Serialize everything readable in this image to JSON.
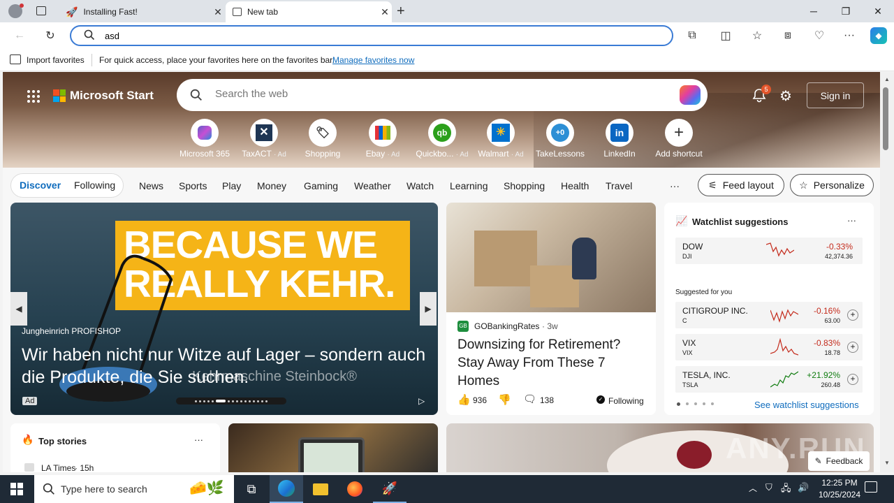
{
  "browser": {
    "tabs": [
      {
        "title": "Installing Fast!"
      },
      {
        "title": "New tab"
      }
    ],
    "address_value": "asd",
    "favbar": {
      "import_label": "Import favorites",
      "hint": "For quick access, place your favorites here on the favorites bar.",
      "manage_link": "Manage favorites now"
    }
  },
  "start": {
    "brand": "Microsoft Start",
    "search_placeholder": "Search the web",
    "notification_count": "5",
    "sign_in": "Sign in",
    "shortcuts": [
      {
        "label": "Microsoft 365",
        "ad": ""
      },
      {
        "label": "TaxACT",
        "ad": "· Ad"
      },
      {
        "label": "Shopping",
        "ad": ""
      },
      {
        "label": "Ebay",
        "ad": "· Ad"
      },
      {
        "label": "Quickbo...",
        "ad": "· Ad"
      },
      {
        "label": "Walmart",
        "ad": "· Ad"
      },
      {
        "label": "TakeLessons",
        "ad": ""
      },
      {
        "label": "LinkedIn",
        "ad": ""
      },
      {
        "label": "Add shortcut",
        "ad": ""
      }
    ]
  },
  "nav": {
    "discover": "Discover",
    "following": "Following",
    "items": [
      "News",
      "Sports",
      "Play",
      "Money",
      "Gaming",
      "Weather",
      "Watch",
      "Learning",
      "Shopping",
      "Health",
      "Travel"
    ],
    "more": "···",
    "feed_layout": "Feed layout",
    "personalize": "Personalize"
  },
  "ad_card": {
    "banner_line1": "BECAUSE WE",
    "banner_line2": "REALLY KEHR.",
    "source": "Jungheinrich PROFISHOP",
    "headline": "Wir haben nicht nur Witze auf Lager – sondern auch die Produkte, die Sie suchen.",
    "overlay": "Kehrmaschine Steinbock®",
    "ad_badge": "Ad"
  },
  "news_card": {
    "source": "GOBankingRates",
    "age": "· 3w",
    "headline": "Downsizing for Retirement? Stay Away From These 7 Homes",
    "likes": "936",
    "comments": "138",
    "following": "Following"
  },
  "watchlist": {
    "title": "Watchlist suggestions",
    "more": "···",
    "suggested_label": "Suggested for you",
    "see_more": "See watchlist suggestions",
    "stocks": [
      {
        "name": "DOW",
        "ticker": "DJI",
        "change": "-0.33%",
        "price": "42,374.36"
      },
      {
        "name": "CITIGROUP INC.",
        "ticker": "C",
        "change": "-0.16%",
        "price": "63.00"
      },
      {
        "name": "VIX",
        "ticker": "VIX",
        "change": "-0.83%",
        "price": "18.78"
      },
      {
        "name": "TESLA, INC.",
        "ticker": "TSLA",
        "change": "+21.92%",
        "price": "260.48"
      }
    ]
  },
  "top_stories": {
    "title": "Top stories",
    "more": "···",
    "first_source": "LA Times",
    "first_age": "· 15h"
  },
  "feedback": "Feedback",
  "watermark": "ANY.RUN",
  "taskbar": {
    "search_placeholder": "Type here to search",
    "time": "12:25 PM",
    "date": "10/25/2024"
  },
  "colors": {
    "accent": "#0f6cbd",
    "negative": "#c42b1c",
    "positive": "#107c10",
    "taskbar": "#1f2a36"
  }
}
